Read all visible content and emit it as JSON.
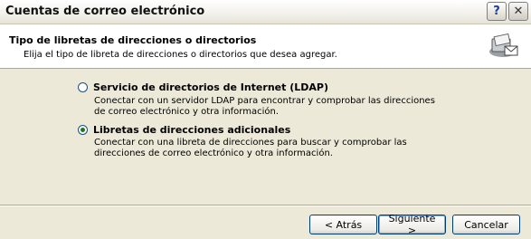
{
  "window": {
    "title": "Cuentas de correo electrónico"
  },
  "header": {
    "title": "Tipo de libretas de direcciones o directorios",
    "subtitle": "Elija el tipo de libreta de direcciones o directorios que desea agregar."
  },
  "options": [
    {
      "label": "Servicio de directorios de Internet (LDAP)",
      "description_lines": [
        "Conectar con un servidor LDAP para encontrar y comprobar las direcciones",
        "de correo electrónico y otra información."
      ],
      "selected": false
    },
    {
      "label": "Libretas de direcciones adicionales",
      "description_lines": [
        "Conectar con una libreta de direcciones para buscar y comprobar las",
        "direcciones de correo electrónico y otra información."
      ],
      "selected": true
    }
  ],
  "buttons": {
    "back": "< Atrás",
    "next": "Siguiente >",
    "cancel": "Cancelar"
  },
  "icons": {
    "help": "?",
    "close": "✕",
    "header": "address-book-icon"
  }
}
